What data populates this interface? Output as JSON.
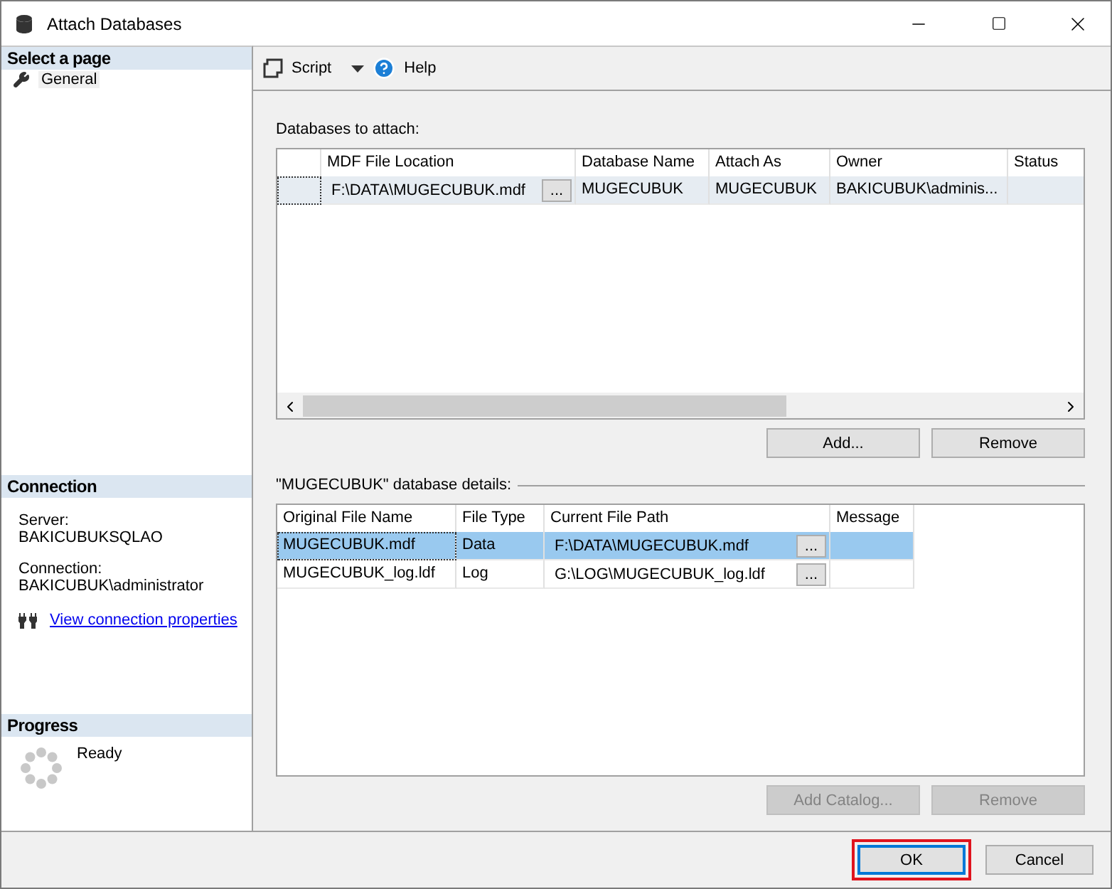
{
  "window": {
    "title": "Attach Databases"
  },
  "sidebar": {
    "header": "Select a page",
    "pages": [
      {
        "label": "General",
        "selected": true
      }
    ]
  },
  "connection": {
    "header": "Connection",
    "server_label": "Server:",
    "server": "BAKICUBUKSQLAO",
    "connection_label": "Connection:",
    "connection": "BAKICUBUK\\administrator",
    "link": "View connection properties"
  },
  "progress": {
    "header": "Progress",
    "status": "Ready"
  },
  "toolbar": {
    "script": "Script",
    "help": "Help"
  },
  "databases": {
    "label": "Databases to attach:",
    "columns": [
      "MDF File Location",
      "Database Name",
      "Attach As",
      "Owner",
      "Status"
    ],
    "rows": [
      {
        "mdf_location": "F:\\DATA\\MUGECUBUK.mdf",
        "browse": "...",
        "database_name": "MUGECUBUK",
        "attach_as": "MUGECUBUK",
        "owner": "BAKICUBUK\\adminis...",
        "selected": true
      }
    ],
    "buttons": [
      {
        "label": "Add...",
        "disabled": false
      },
      {
        "label": "Remove",
        "disabled": false
      }
    ]
  },
  "details": {
    "label": "\"MUGECUBUK\" database details:",
    "columns": [
      "Original File Name",
      "File Type",
      "Current File Path",
      "Message"
    ],
    "rows": [
      {
        "original_name": "MUGECUBUK.mdf",
        "file_type": "Data",
        "current_path": "F:\\DATA\\MUGECUBUK.mdf",
        "browse": "...",
        "selected": true
      },
      {
        "original_name": "MUGECUBUK_log.ldf",
        "file_type": "Log",
        "current_path": "G:\\LOG\\MUGECUBUK_log.ldf",
        "browse": "...",
        "selected": false
      }
    ],
    "buttons": [
      {
        "label": "Add Catalog...",
        "disabled": true
      },
      {
        "label": "Remove",
        "disabled": true
      }
    ]
  },
  "footer": {
    "buttons": [
      {
        "label": "OK",
        "default": true,
        "highlighted": true
      },
      {
        "label": "Cancel",
        "default": false,
        "highlighted": false
      }
    ]
  }
}
